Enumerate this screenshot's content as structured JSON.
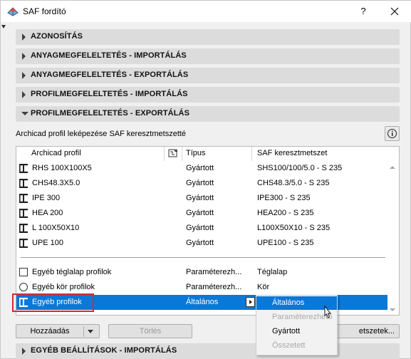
{
  "window": {
    "title": "SAF fordító",
    "help_label": "?"
  },
  "sections": [
    {
      "label": "AZONOSÍTÁS",
      "expanded": false
    },
    {
      "label": "ANYAGMEGFELELTETÉS - IMPORTÁLÁS",
      "expanded": false
    },
    {
      "label": "ANYAGMEGFELELTETÉS - EXPORTÁLÁS",
      "expanded": false
    },
    {
      "label": "PROFILMEGFELELTETÉS - IMPORTÁLÁS",
      "expanded": false
    },
    {
      "label": "PROFILMEGFELELTETÉS - EXPORTÁLÁS",
      "expanded": true
    },
    {
      "label": "EGYÉB BEÁLLÍTÁSOK - IMPORTÁLÁS",
      "expanded": false
    }
  ],
  "panel": {
    "subtitle": "Archicad profil leképezése SAF keresztmetszetté",
    "info_icon": "info-icon"
  },
  "table": {
    "headers": [
      "Archicad profil",
      "Típus",
      "SAF keresztmetszet"
    ],
    "header_icon": "profile-edit-icon",
    "profile_rows": [
      {
        "profile": "RHS 100X100X5",
        "type": "Gyártott",
        "saf": "SHS100/100/5.0 - S 235"
      },
      {
        "profile": "CHS48.3X5.0",
        "type": "Gyártott",
        "saf": "CHS48.3/5.0 - S 235"
      },
      {
        "profile": "IPE 300",
        "type": "Gyártott",
        "saf": "IPE300 - S 235"
      },
      {
        "profile": "HEA 200",
        "type": "Gyártott",
        "saf": "HEA200 - S 235"
      },
      {
        "profile": "L 100X50X10",
        "type": "Gyártott",
        "saf": "L100X50X10 - S 235"
      },
      {
        "profile": "UPE 100",
        "type": "Gyártott",
        "saf": "UPE100 - S 235"
      }
    ],
    "other_rows": [
      {
        "profile": "Egyéb téglalap profilok",
        "type": "Paraméterezh...",
        "saf": "Téglalap",
        "control": "checkbox"
      },
      {
        "profile": "Egyéb kör profilok",
        "type": "Paraméterezh...",
        "saf": "Kör",
        "control": "radio"
      },
      {
        "profile": "Egyéb profilok",
        "type": "Általános",
        "saf": "",
        "control": "profile",
        "selected": true
      }
    ]
  },
  "buttons": {
    "add": "Hozzáadás",
    "delete": "Törlés",
    "saf_sections": "etszetek..."
  },
  "type_dropdown": {
    "options": [
      {
        "label": "Általános",
        "state": "highlighted"
      },
      {
        "label": "Paraméterezhető",
        "state": "disabled"
      },
      {
        "label": "Gyártott",
        "state": "enabled"
      },
      {
        "label": "Összetett",
        "state": "disabled"
      }
    ]
  },
  "colors": {
    "selection": "#0a78d7",
    "highlight_outline": "#e0262a",
    "section_bar": "#dcdcdc"
  }
}
